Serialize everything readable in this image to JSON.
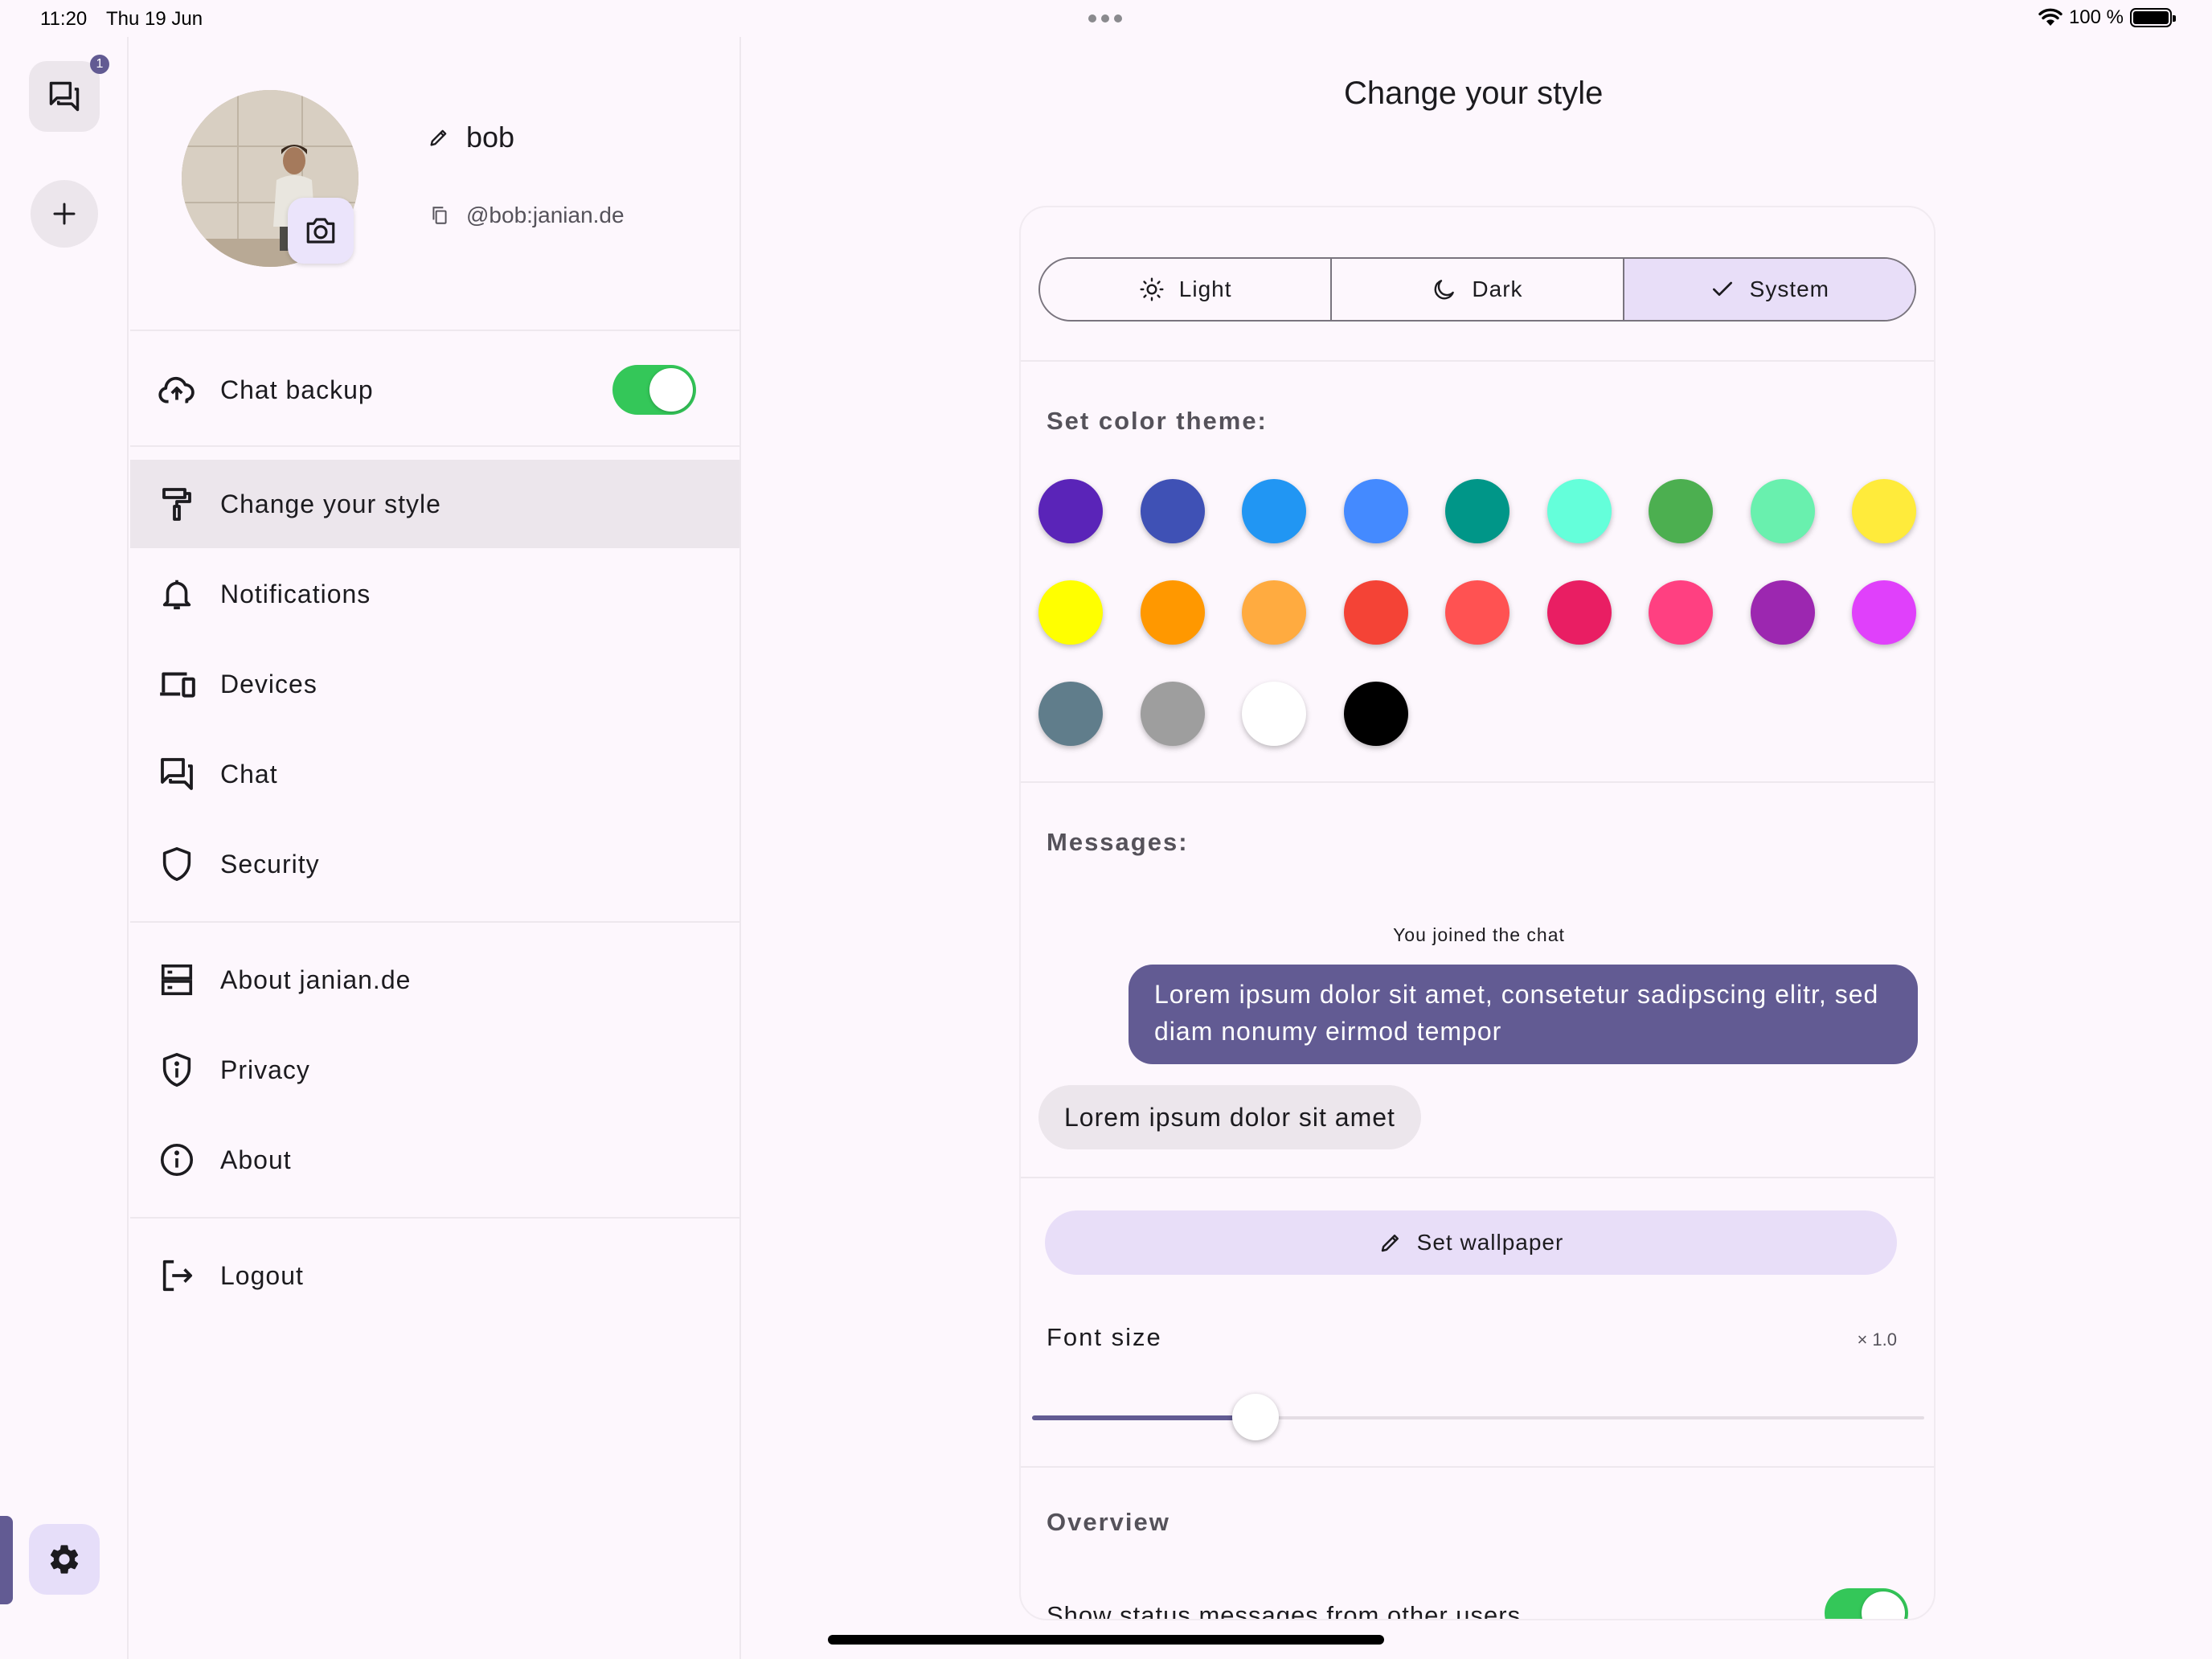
{
  "status_bar": {
    "time": "11:20",
    "date": "Thu 19 Jun",
    "battery": "100 %"
  },
  "nav_rail": {
    "unread_badge": "1",
    "icons": [
      "chats-icon",
      "plus-icon",
      "gear-icon"
    ]
  },
  "profile": {
    "name": "bob",
    "user_id": "@bob:janian.de"
  },
  "menu": {
    "chat_backup": "Chat backup",
    "chat_backup_enabled": true,
    "change_style": "Change your style",
    "notifications": "Notifications",
    "devices": "Devices",
    "chat": "Chat",
    "security": "Security",
    "about_server": "About janian.de",
    "privacy": "Privacy",
    "about": "About",
    "logout": "Logout"
  },
  "style_page": {
    "title": "Change your style",
    "theme_modes": [
      {
        "label": "Light",
        "icon": "sun-icon",
        "selected": false
      },
      {
        "label": "Dark",
        "icon": "moon-icon",
        "selected": false
      },
      {
        "label": "System",
        "icon": "check-icon",
        "selected": true
      }
    ],
    "color_theme_label": "Set color theme:",
    "colors": [
      "#5a24b8",
      "#3f51b5",
      "#2196f3",
      "#448aff",
      "#009688",
      "#64ffda",
      "#4caf50",
      "#69f0ae",
      "#ffeb3b",
      "#ffff00",
      "#ff9800",
      "#ffab40",
      "#f44336",
      "#ff5252",
      "#e91e63",
      "#ff4081",
      "#9c27b0",
      "#e040fb",
      "#607d8b",
      "#9e9e9e",
      "#ffffff",
      "#000000"
    ],
    "messages_label": "Messages:",
    "system_message": "You joined the chat",
    "outgoing_message": "Lorem ipsum dolor sit amet, consetetur sadipscing elitr, sed diam nonumy eirmod tempor",
    "incoming_message": "Lorem ipsum dolor sit amet",
    "wallpaper_button": "Set wallpaper",
    "font_size_label": "Font size",
    "font_size_value": "× 1.0",
    "font_size_fraction": 0.25,
    "overview_label": "Overview",
    "status_messages_label": "Show status messages from other users",
    "status_messages_enabled": true
  },
  "accent_color": "#625b93",
  "toggle_color": "#34c759"
}
